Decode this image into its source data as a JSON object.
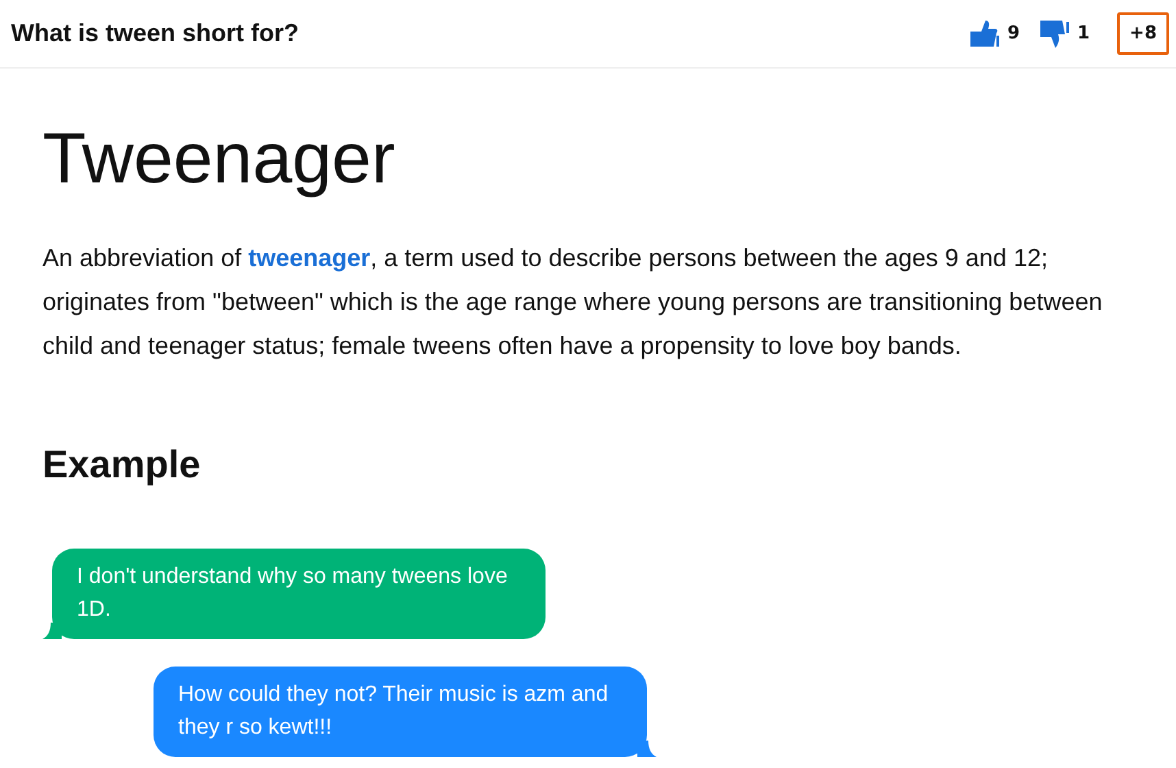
{
  "question": "What is tween short for?",
  "votes": {
    "up": "9",
    "down": "1",
    "extra": "+8"
  },
  "term": "Tweenager",
  "definition": {
    "before": "An abbreviation of ",
    "link": "tweenager",
    "after": ", a term used to describe persons between the ages 9 and 12; originates from \"between\" which is the age range where young persons are transitioning between child and teenager status; female tweens often have a propensity to love boy bands."
  },
  "example_heading": "Example",
  "messages": [
    {
      "kind": "received",
      "color": "#00b377",
      "text": "I don't understand why so many tweens love 1D."
    },
    {
      "kind": "sent",
      "color": "#1a88ff",
      "text": "How could they not? Their music is azm and they r so kewt!!!"
    }
  ]
}
